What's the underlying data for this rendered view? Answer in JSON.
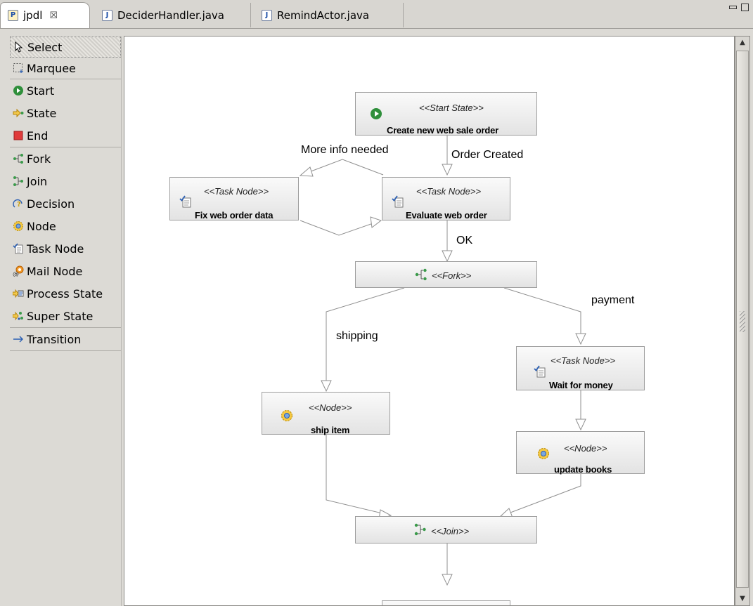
{
  "tabs": [
    {
      "label": "jpdl",
      "icon": "process-file-icon",
      "close": "☒",
      "active": true
    },
    {
      "label": "DeciderHandler.java",
      "icon": "java-file-icon",
      "active": false
    },
    {
      "label": "RemindActor.java",
      "icon": "java-file-icon",
      "active": false
    }
  ],
  "palette": {
    "tools": [
      {
        "label": "Select",
        "icon": "arrow-pointer-icon"
      },
      {
        "label": "Marquee",
        "icon": "marquee-icon"
      }
    ],
    "states": [
      {
        "label": "Start",
        "icon": "start-icon"
      },
      {
        "label": "State",
        "icon": "state-icon"
      },
      {
        "label": "End",
        "icon": "end-icon"
      }
    ],
    "nodes": [
      {
        "label": "Fork",
        "icon": "fork-icon"
      },
      {
        "label": "Join",
        "icon": "join-icon"
      },
      {
        "label": "Decision",
        "icon": "decision-icon"
      },
      {
        "label": "Node",
        "icon": "node-gear-icon"
      },
      {
        "label": "Task Node",
        "icon": "task-node-icon"
      },
      {
        "label": "Mail Node",
        "icon": "mail-node-icon"
      },
      {
        "label": "Process State",
        "icon": "process-state-icon"
      },
      {
        "label": "Super State",
        "icon": "super-state-icon"
      }
    ],
    "connections": [
      {
        "label": "Transition",
        "icon": "transition-arrow-icon"
      }
    ]
  },
  "diagram": {
    "nodes": {
      "start": {
        "stereotype": "<<Start State>>",
        "name": "Create new web sale order"
      },
      "fix": {
        "stereotype": "<<Task Node>>",
        "name": "Fix web order data"
      },
      "evaluate": {
        "stereotype": "<<Task Node>>",
        "name": "Evaluate web order"
      },
      "fork": {
        "stereotype": "<<Fork>>"
      },
      "wait": {
        "stereotype": "<<Task Node>>",
        "name": "Wait for money"
      },
      "ship": {
        "stereotype": "<<Node>>",
        "name": "ship item"
      },
      "update": {
        "stereotype": "<<Node>>",
        "name": "update books"
      },
      "join": {
        "stereotype": "<<Join>>"
      }
    },
    "transitions": {
      "order_created": "Order Created",
      "more_info": "More info needed",
      "ok": "OK",
      "payment": "payment",
      "shipping": "shipping"
    }
  },
  "colors": {
    "canvas": "#ffffff",
    "node_border": "#9e9e9e",
    "connector": "#8f8f8f",
    "panel": "#dcdad5"
  }
}
